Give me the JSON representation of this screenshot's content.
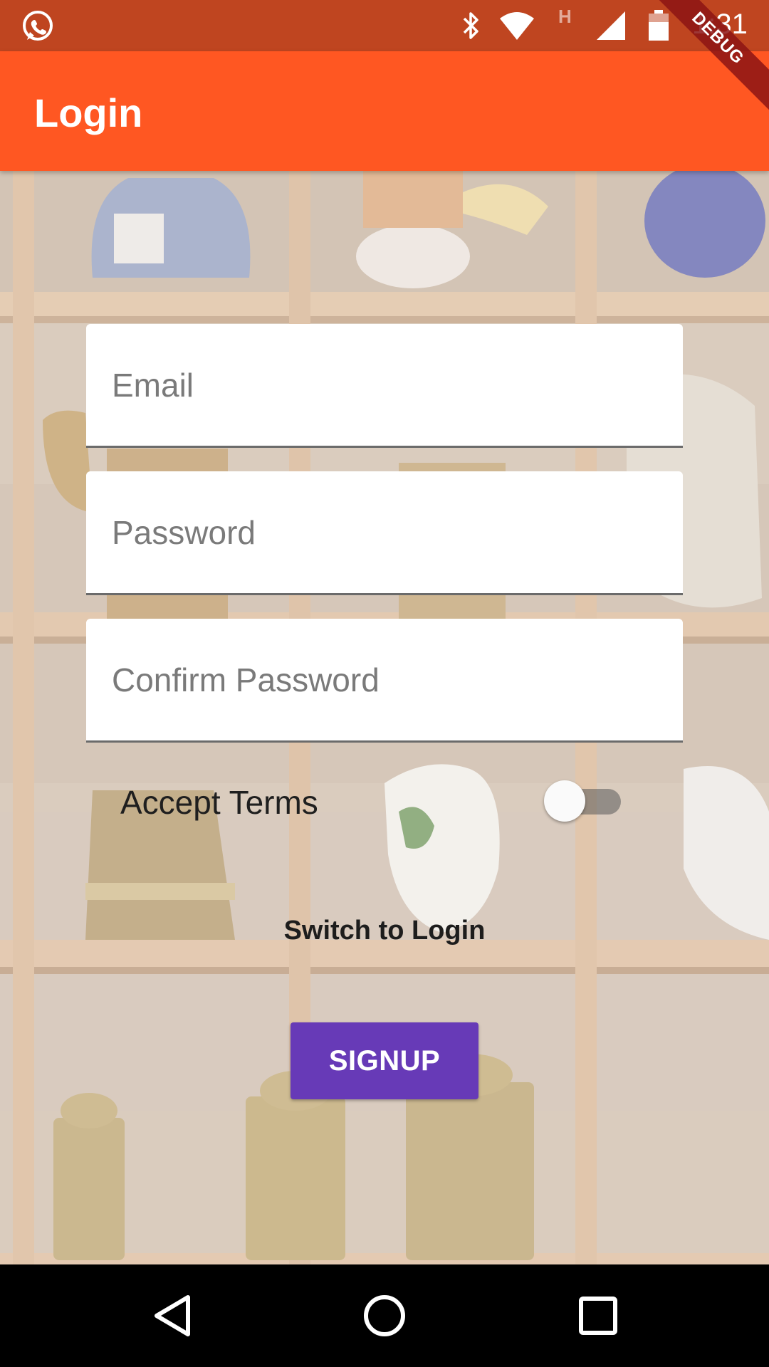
{
  "status_bar": {
    "time": "1:31",
    "network_type": "H",
    "icons": [
      "whatsapp-icon",
      "bluetooth-icon",
      "wifi-icon",
      "signal-icon",
      "battery-icon"
    ]
  },
  "debug_banner": "DEBUG",
  "app_bar": {
    "title": "Login",
    "color": "#FF5722",
    "status_color": "#BF4520"
  },
  "form": {
    "email": {
      "placeholder": "Email",
      "value": ""
    },
    "password": {
      "placeholder": "Password",
      "value": ""
    },
    "confirm_password": {
      "placeholder": "Confirm Password",
      "value": ""
    },
    "terms": {
      "label": "Accept Terms",
      "checked": false
    },
    "switch_link": "Switch to Login",
    "submit_label": "SIGNUP",
    "submit_color": "#673AB7"
  },
  "nav_bar": {
    "icons": [
      "back-icon",
      "home-icon",
      "recents-icon"
    ]
  }
}
